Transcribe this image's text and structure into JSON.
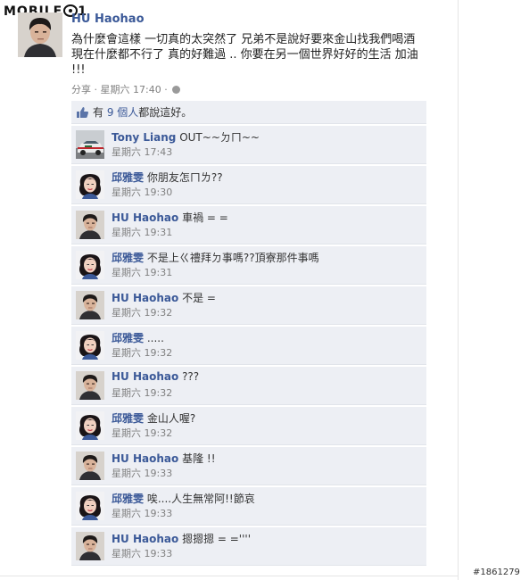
{
  "watermark": {
    "text_before": "MOBILE",
    "text_after": "1"
  },
  "post": {
    "author": "HU Haohao",
    "text": "為什麼會這樣 一切真的太突然了 兄弟不是說好要來金山找我們喝酒 現在什麼都不行了 真的好難過 .. 你要在另一個世界好好的生活 加油 !!!",
    "share": "分享",
    "time": "星期六 17:40",
    "separator": "·"
  },
  "likes": {
    "prefix": "有",
    "count": "9 個人",
    "suffix": "都說這好。"
  },
  "comments": [
    {
      "name": "Tony Liang",
      "text": "OUT~~ㄉㄇ~~",
      "time": "星期六 17:43",
      "avatar": "car"
    },
    {
      "name": "邱雅雯",
      "text": "你朋友怎ㄇㄌ??",
      "time": "星期六 19:30",
      "avatar": "woman"
    },
    {
      "name": "HU Haohao",
      "text": "車禍 = =",
      "time": "星期六 19:31",
      "avatar": "man"
    },
    {
      "name": "邱雅雯",
      "text": "不是上ㄍ禮拜ㄉ事嗎??頂寮那件事嗎",
      "time": "星期六 19:31",
      "avatar": "woman"
    },
    {
      "name": "HU Haohao",
      "text": "不是 =",
      "time": "星期六 19:32",
      "avatar": "man"
    },
    {
      "name": "邱雅雯",
      "text": ".....",
      "time": "星期六 19:32",
      "avatar": "woman"
    },
    {
      "name": "HU Haohao",
      "text": "???",
      "time": "星期六 19:32",
      "avatar": "man"
    },
    {
      "name": "邱雅雯",
      "text": "金山人喔?",
      "time": "星期六 19:32",
      "avatar": "woman"
    },
    {
      "name": "HU Haohao",
      "text": "基隆 !!",
      "time": "星期六 19:33",
      "avatar": "man"
    },
    {
      "name": "邱雅雯",
      "text": "唉....人生無常阿!!節哀",
      "time": "星期六 19:33",
      "avatar": "woman"
    },
    {
      "name": "HU Haohao",
      "text": "摁摁摁 = =''''",
      "time": "星期六 19:33",
      "avatar": "man"
    }
  ],
  "image_id": "#1861279",
  "colors": {
    "link": "#3b5998",
    "comment_bg": "#edeff4",
    "meta": "#808080"
  }
}
